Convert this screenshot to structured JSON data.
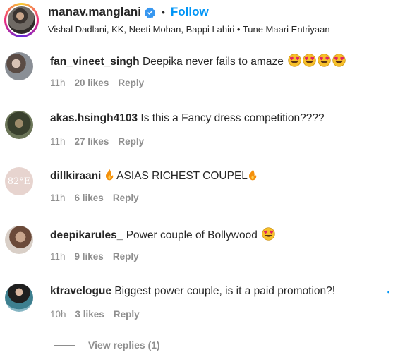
{
  "post": {
    "username": "manav.manglani",
    "separator": "•",
    "follow_label": "Follow",
    "subtitle": "Vishal Dadlani, KK, Neeti Mohan, Bappi Lahiri • Tune Maari Entriyaan"
  },
  "comments": [
    {
      "username": "fan_vineet_singh",
      "text": "Deepika never fails to amaze",
      "emoji": [
        "heart-eyes",
        "heart-eyes",
        "heart-eyes",
        "heart-eyes"
      ],
      "time": "11h",
      "likes": "20 likes",
      "reply": "Reply"
    },
    {
      "username": "akas.hsingh4103",
      "text": "Is this a Fancy dress competition????",
      "time": "11h",
      "likes": "27 likes",
      "reply": "Reply"
    },
    {
      "username": "dillkiraani",
      "avatar_text": "82°E",
      "text": "ASIAS RICHEST COUPEL",
      "emoji": [
        "fire",
        "fire"
      ],
      "time": "11h",
      "likes": "6 likes",
      "reply": "Reply"
    },
    {
      "username": "deepikarules_",
      "text": "Power couple of Bollywood",
      "emoji": [
        "heart-eyes"
      ],
      "time": "11h",
      "likes": "9 likes",
      "reply": "Reply"
    },
    {
      "username": "ktravelogue",
      "text": "Biggest power couple, is it a paid promotion?!",
      "time": "10h",
      "likes": "3 likes",
      "reply": "Reply"
    }
  ],
  "view_replies_label": "View replies (1)",
  "colors": {
    "accent": "#0095f6",
    "text": "#262626",
    "secondary": "#8e8e8e",
    "verified": "#3897f0"
  }
}
